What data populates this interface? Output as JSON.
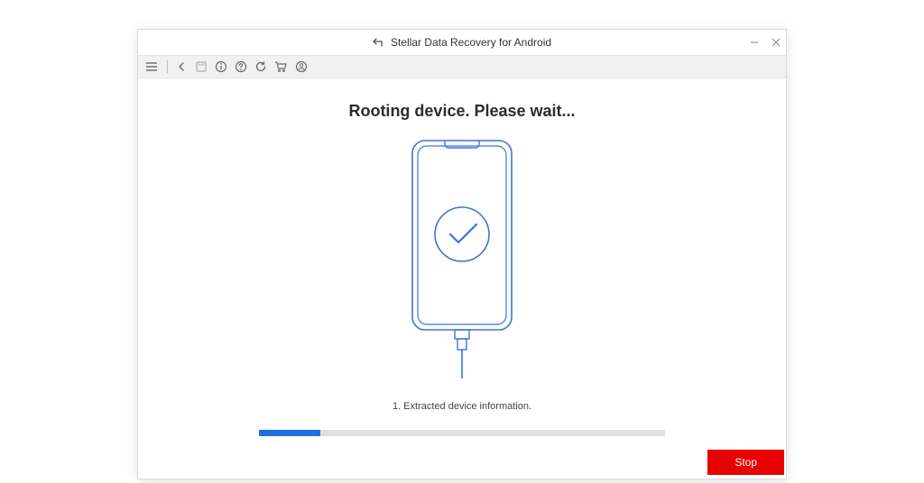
{
  "window": {
    "title": "Stellar Data Recovery for Android"
  },
  "content": {
    "heading": "Rooting device. Please wait...",
    "status": "1. Extracted device information.",
    "progress_percent": 15
  },
  "actions": {
    "stop_label": "Stop"
  },
  "colors": {
    "accent": "#1e6fe0",
    "danger": "#e60000"
  }
}
